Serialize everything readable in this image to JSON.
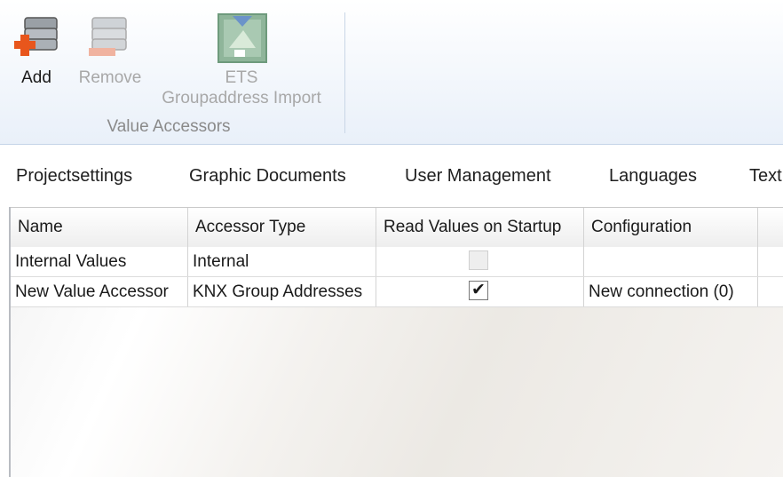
{
  "ribbon": {
    "add_label": "Add",
    "remove_label": "Remove",
    "ets_label_line1": "ETS",
    "ets_label_line2": "Groupaddress Import",
    "group_label": "Value Accessors"
  },
  "tabs": [
    {
      "label": "Projectsettings"
    },
    {
      "label": "Graphic Documents"
    },
    {
      "label": "User Management"
    },
    {
      "label": "Languages"
    },
    {
      "label": "Text"
    }
  ],
  "grid": {
    "columns": [
      "Name",
      "Accessor Type",
      "Read Values on Startup",
      "Configuration"
    ],
    "rows": [
      {
        "name": "Internal Values",
        "type": "Internal",
        "read_on_startup": false,
        "read_enabled": false,
        "configuration": ""
      },
      {
        "name": "New Value Accessor",
        "type": "KNX Group Addresses",
        "read_on_startup": true,
        "read_enabled": true,
        "configuration": "New connection (0)"
      }
    ]
  },
  "icons": {
    "add": "server-add-icon",
    "remove": "server-remove-icon",
    "ets": "ets-import-icon"
  },
  "colors": {
    "ribbon_bg": "#e9f0f9",
    "disabled_text": "#a8a8a8",
    "add_accent": "#e8561c"
  }
}
